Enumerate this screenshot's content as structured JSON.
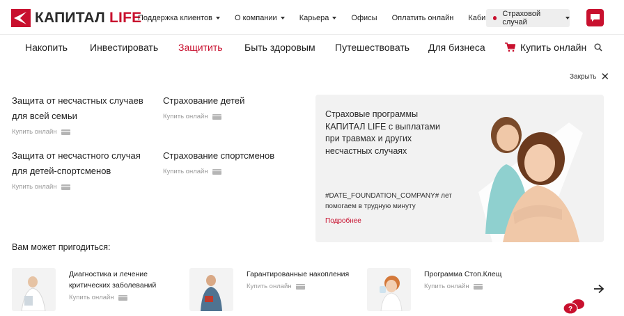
{
  "brand": {
    "name_main": "КАПИТАЛ",
    "name_accent": "LIFE",
    "accent_color": "#c8102e"
  },
  "top_nav": [
    {
      "label": "Поддержка клиентов",
      "dropdown": true
    },
    {
      "label": "О компании",
      "dropdown": true
    },
    {
      "label": "Карьера",
      "dropdown": true
    },
    {
      "label": "Офисы",
      "dropdown": false
    },
    {
      "label": "Оплатить онлайн",
      "dropdown": false
    },
    {
      "label": "Кабинет клиента",
      "dropdown": false
    }
  ],
  "insurance_case": {
    "label": "Страховой случай"
  },
  "main_nav": {
    "items": [
      "Накопить",
      "Инвестировать",
      "Защитить",
      "Быть здоровым",
      "Путешествовать",
      "Для бизнеса"
    ],
    "active": "Защитить",
    "buy_online": "Купить онлайн"
  },
  "close_label": "Закрыть",
  "products": [
    {
      "title_line1": "Защита от несчастных случаев",
      "title_line2": "для всей семьи",
      "buy": "Купить онлайн"
    },
    {
      "title_line1": "Страхование детей",
      "title_line2": "",
      "buy": "Купить онлайн"
    },
    {
      "title_line1": "Защита от несчастного случая",
      "title_line2": "для детей-спортсменов",
      "buy": "Купить онлайн"
    },
    {
      "title_line1": "Страхование спортсменов",
      "title_line2": "",
      "buy": "Купить онлайн"
    }
  ],
  "promo": {
    "title_line1": "Страховые программы",
    "title_line2": "КАПИТАЛ LIFE с выплатами",
    "title_line3": "при травмах и других",
    "title_line4": "несчастных случаях",
    "note_line1": "#DATE_FOUNDATION_COMPANY# лет",
    "note_line2": "помогаем в трудную минуту",
    "more": "Подробнее"
  },
  "useful_title": "Вам может пригодиться:",
  "recommendations": [
    {
      "title_line1": "Диагностика и лечение",
      "title_line2": "критических заболеваний",
      "buy": "Купить онлайн"
    },
    {
      "title_line1": "Гарантированные накопления",
      "title_line2": "",
      "buy": "Купить онлайн"
    },
    {
      "title_line1": "Программа Стоп.Клещ",
      "title_line2": "",
      "buy": "Купить онлайн"
    }
  ]
}
